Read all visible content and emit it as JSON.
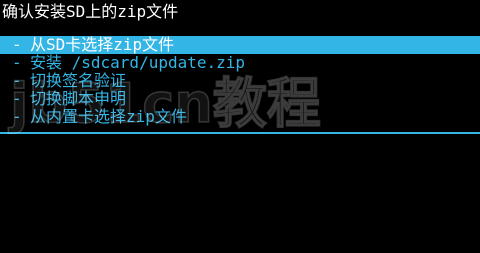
{
  "header": {
    "title": "确认安装SD上的zip文件"
  },
  "menu": {
    "items": [
      {
        "label": "从SD卡选择zip文件",
        "selected": true
      },
      {
        "label": "安装 /sdcard/update.zip",
        "selected": false
      },
      {
        "label": "切换签名验证",
        "selected": false
      },
      {
        "label": "切换脚本申明",
        "selected": false
      },
      {
        "label": "从内置卡选择zip文件",
        "selected": false
      }
    ],
    "bullet": "-"
  },
  "watermark": {
    "text": "jb51cn教程"
  },
  "colors": {
    "accent": "#33b5e5",
    "background": "#000000",
    "text": "#ffffff"
  }
}
